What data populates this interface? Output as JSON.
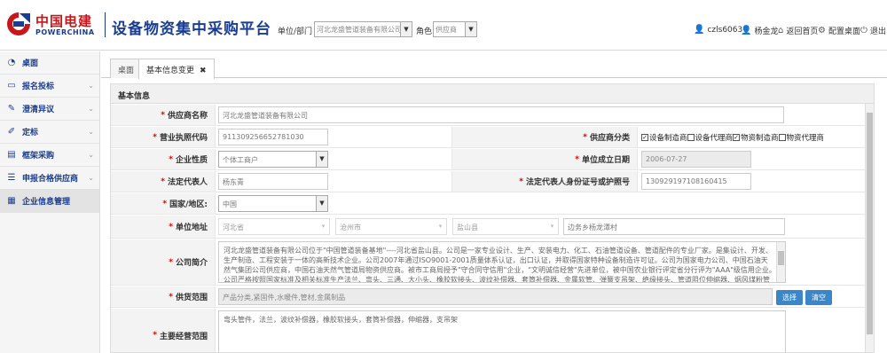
{
  "header": {
    "logo_cn": "中国电建",
    "logo_en": "POWERCHINA",
    "app_title": "设备物资集中采购平台",
    "unit_label": "单位/部门",
    "unit_value": "河北龙盛管道装备有限公司",
    "role_label": "角色",
    "role_value": "供应商",
    "user_id": "czls6063",
    "user_name": "杨金龙",
    "home_link": "返回首页",
    "config_link": "配置桌面",
    "logout_link": "退出"
  },
  "sidebar": {
    "items": [
      {
        "label": "桌面",
        "icon": "dashboard-icon"
      },
      {
        "label": "报名投标",
        "icon": "book-icon"
      },
      {
        "label": "澄清异议",
        "icon": "wrench-icon"
      },
      {
        "label": "定标",
        "icon": "pencil-icon"
      },
      {
        "label": "框架采购",
        "icon": "note-icon"
      },
      {
        "label": "申报合格供应商",
        "icon": "list-icon"
      },
      {
        "label": "企业信息管理",
        "icon": "table-icon"
      }
    ]
  },
  "tabs": [
    {
      "label": "桌面"
    },
    {
      "label": "基本信息变更",
      "close": "✖"
    }
  ],
  "section_title": "基本信息",
  "form": {
    "supplier_name_label": "供应商名称",
    "supplier_name": "河北龙盛管道装备有限公司",
    "license_label": "营业执照代码",
    "license": "911309256652781030",
    "category_label": "供应商分类",
    "categories": [
      {
        "label": "设备制造商",
        "checked": true
      },
      {
        "label": "设备代理商",
        "checked": false
      },
      {
        "label": "物资制造商",
        "checked": true
      },
      {
        "label": "物资代理商",
        "checked": false
      }
    ],
    "nature_label": "企业性质",
    "nature": "个体工商户",
    "founded_label": "单位成立日期",
    "founded": "2006-07-27",
    "legal_rep_label": "法定代表人",
    "legal_rep": "杨东青",
    "legal_id_label": "法定代表人身份证号或护照号",
    "legal_id": "130929197108160415",
    "country_label": "国家/地区:",
    "country": "中国",
    "address_label": "单位地址",
    "province": "河北省",
    "city": "沧州市",
    "county": "盐山县",
    "street": "边务乡杨龙潭村",
    "intro_label": "公司简介",
    "intro": "河北龙盛管道装备有限公司位于\"中国管道装备基地\"----河北省盐山县。公司是一家专业设计、生产、安装电力、化工、石油管道设备、管道配件的专业厂家。是集设计、开发、生产制造、工程安装于一体的高新技术企业。公司2007年通过ISO9001-2001质量体系认证，出口认证，并取得国家特种设备制造许可证。公司为国家电力公司、中国石油天然气集团公司供应商，中国石油天然气管道局物资供应商。被市工商局授予\"守合同守信用\"企业，\"文明诚信经营\"先进单位，被中国农业银行评定省分行评为\"AAA\"级信用企业。　　公司严格按照国家标准及相关标准生产法兰、弯头、三通、大小头、橡胶软接头、波纹补偿器、套筒补偿器、金属软管、弹簧支吊架、绝缘接头、管道阻位伸缩器、烟风煤粉管道设备、电力管道零部件、化工管道零部件、石油管道零部件、给排水管道零部件等产品。",
    "scope_label": "供货范围",
    "scope": "产品分类,紧固件,水暖件,管材,金属制品",
    "select_btn": "选择",
    "clear_btn": "清空",
    "main_scope_label": "主要经营范围",
    "main_scope": "弯头管件，法兰，波纹补偿器，橡胶软接头，套筒补偿器，伸缩器，支吊架"
  }
}
